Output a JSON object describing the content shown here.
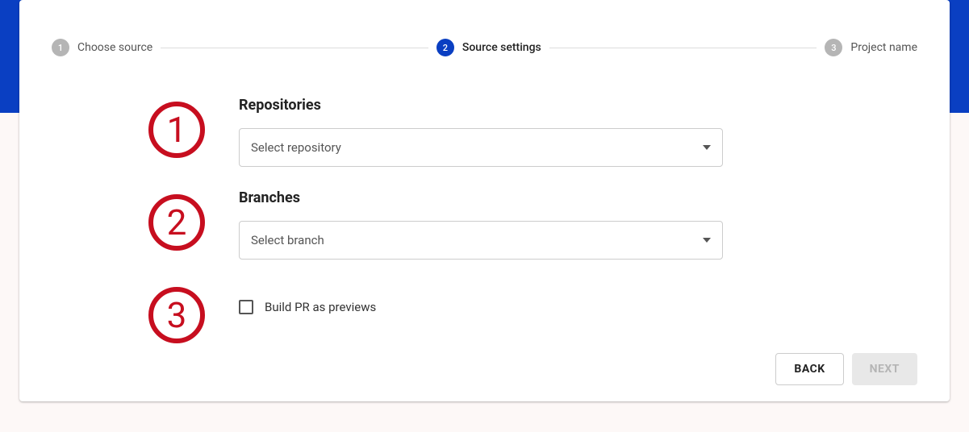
{
  "stepper": {
    "steps": [
      {
        "number": "1",
        "label": "Choose source",
        "active": false
      },
      {
        "number": "2",
        "label": "Source settings",
        "active": true
      },
      {
        "number": "3",
        "label": "Project name",
        "active": false
      }
    ]
  },
  "annotations": {
    "one": "1",
    "two": "2",
    "three": "3"
  },
  "form": {
    "repositories": {
      "label": "Repositories",
      "placeholder": "Select repository"
    },
    "branches": {
      "label": "Branches",
      "placeholder": "Select branch"
    },
    "buildPr": {
      "label": "Build PR as previews",
      "checked": false
    }
  },
  "footer": {
    "back": "BACK",
    "next": "NEXT"
  },
  "colors": {
    "accent": "#0a3fc2",
    "annotation": "#c70e1f"
  }
}
